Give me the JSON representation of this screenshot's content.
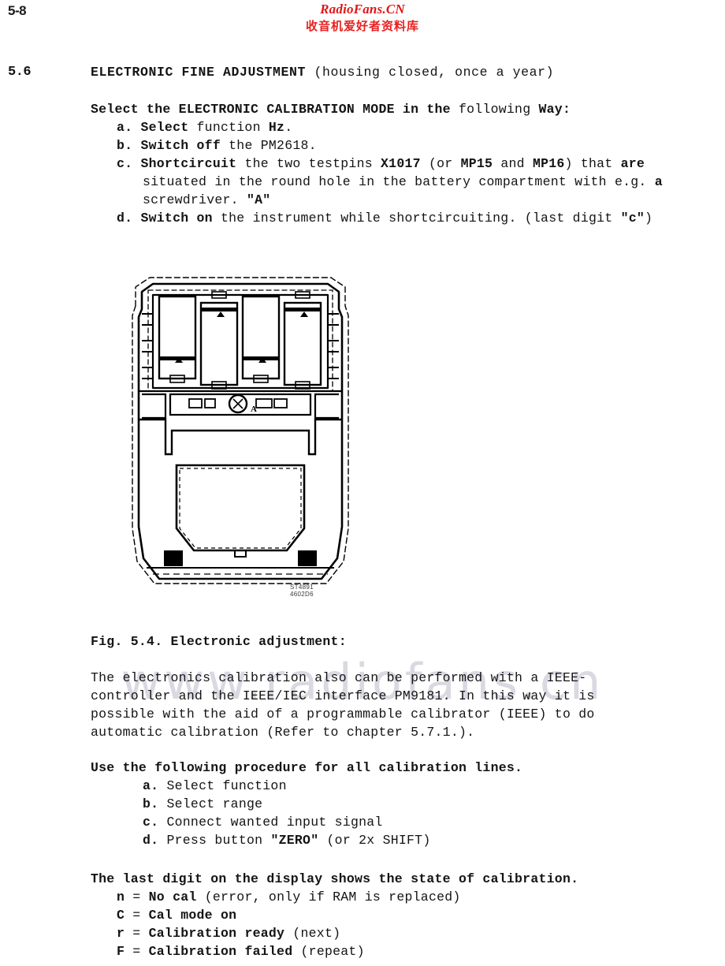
{
  "page": {
    "number": "5-8",
    "watermark_body": "www.radiofans.cn"
  },
  "brand": {
    "latin": "RadioFans.CN",
    "cjk": "收音机爱好者资料库",
    "color": "#e11616"
  },
  "section": {
    "number": "5.6",
    "heading_bold": "ELECTRONIC FINE ADJUSTMENT",
    "heading_rest": " (housing closed, once a year)"
  },
  "intro": {
    "lead_bold_1": "Select the ELECTRONIC CALIBRATION MODE in the",
    "lead_rest_1": " following ",
    "lead_bold_2": "Way:",
    "items": [
      {
        "marker": "a.",
        "lines": [
          [
            {
              "t": " Select",
              "b": true
            },
            {
              "t": " function ",
              "b": false
            },
            {
              "t": "Hz",
              "b": true
            },
            {
              "t": ".",
              "b": false
            }
          ]
        ]
      },
      {
        "marker": "b.",
        "lines": [
          [
            {
              "t": " Switch off",
              "b": true
            },
            {
              "t": " the PM2618.",
              "b": false
            }
          ]
        ]
      },
      {
        "marker": "c.",
        "lines": [
          [
            {
              "t": " Shortcircuit",
              "b": true
            },
            {
              "t": " the two testpins ",
              "b": false
            },
            {
              "t": "X1017",
              "b": true
            },
            {
              "t": " (or ",
              "b": false
            },
            {
              "t": "MP15",
              "b": true
            },
            {
              "t": " and ",
              "b": false
            },
            {
              "t": "MP16",
              "b": true
            },
            {
              "t": ") that ",
              "b": false
            },
            {
              "t": "are",
              "b": true
            }
          ],
          [
            {
              "t": "situated in the round hole in the battery compartment with e.g. ",
              "b": false
            },
            {
              "t": "a",
              "b": true
            }
          ],
          [
            {
              "t": "screwdriver. ",
              "b": false
            },
            {
              "t": "\"A\"",
              "b": true
            }
          ]
        ]
      },
      {
        "marker": "d.",
        "lines": [
          [
            {
              "t": " Switch on",
              "b": true
            },
            {
              "t": " the instrument while shortcircuiting. (last digit ",
              "b": false
            },
            {
              "t": "\"c\"",
              "b": true
            },
            {
              "t": ")",
              "b": false
            }
          ]
        ]
      }
    ]
  },
  "figure": {
    "caption": "Fig. 5.4. Electronic adjustment:",
    "code_line_1": "ST4891",
    "code_line_2": "4602D6",
    "hole_label": "A",
    "battery_count": 4,
    "alt": "Top view drawing of the PM2618 battery compartment showing four batteries and the round hole with testpins marked A"
  },
  "paragraph": {
    "lines": [
      "The electronics calibration also can be performed with a IEEE-",
      "controller and the IEEE/IEC interface PM9181. In this way it is",
      "possible with the aid of a programmable calibrator (IEEE) to do",
      "automatic calibration (Refer to chapter 5.7.1.)."
    ]
  },
  "procedure": {
    "heading": "Use the following procedure for all calibration lines.",
    "items": [
      {
        "marker": "a.",
        "parts": [
          {
            "t": " Select function",
            "b": false
          }
        ]
      },
      {
        "marker": "b.",
        "parts": [
          {
            "t": " Select range",
            "b": false
          }
        ]
      },
      {
        "marker": "c.",
        "parts": [
          {
            "t": " Connect wanted input signal",
            "b": false
          }
        ]
      },
      {
        "marker": "d.",
        "parts": [
          {
            "t": " Press button ",
            "b": false
          },
          {
            "t": "\"ZERO\"",
            "b": true
          },
          {
            "t": " (or 2x SHIFT)",
            "b": false
          }
        ]
      }
    ]
  },
  "states": {
    "heading": "The last digit on the display shows the state of calibration.",
    "items": [
      {
        "code": "n",
        "parts": [
          {
            "t": " = ",
            "b": false
          },
          {
            "t": "No cal",
            "b": true
          },
          {
            "t": " (error, only if RAM is replaced)",
            "b": false
          }
        ]
      },
      {
        "code": "C",
        "parts": [
          {
            "t": " = ",
            "b": false
          },
          {
            "t": "Cal mode on",
            "b": true
          }
        ]
      },
      {
        "code": "r",
        "parts": [
          {
            "t": " = ",
            "b": false
          },
          {
            "t": "Calibration ready",
            "b": true
          },
          {
            "t": " (next)",
            "b": false
          }
        ]
      },
      {
        "code": "F",
        "parts": [
          {
            "t": " = ",
            "b": false
          },
          {
            "t": "Calibration failed",
            "b": true
          },
          {
            "t": " (repeat)",
            "b": false
          }
        ]
      }
    ]
  }
}
